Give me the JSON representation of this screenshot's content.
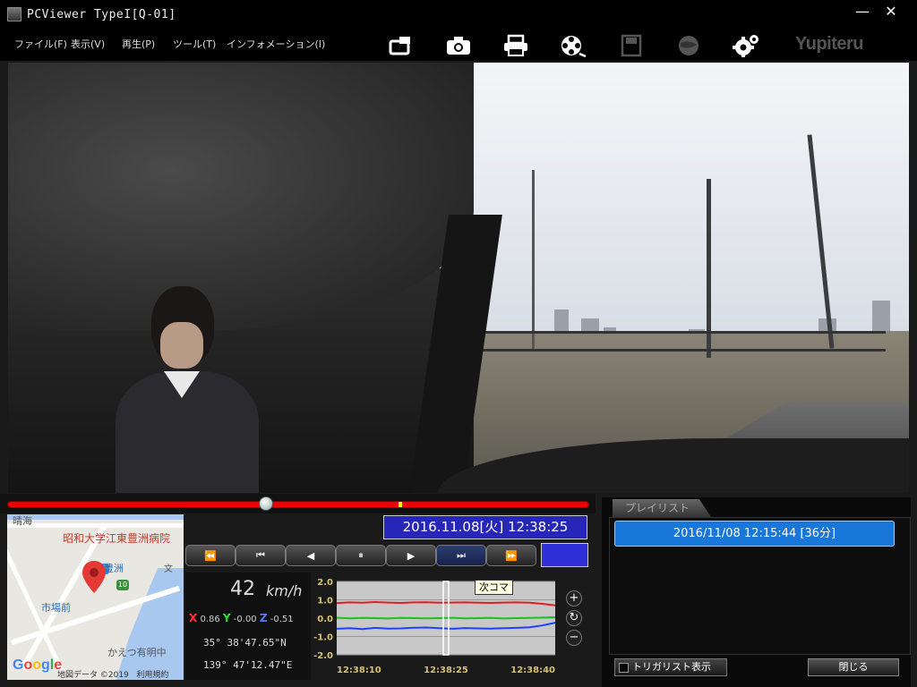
{
  "window": {
    "title": "PCViewer TypeI[Q-01]",
    "min_label": "—",
    "close_label": "✕"
  },
  "menu": {
    "items": [
      "ファイル(F)",
      "表示(V)",
      "再生(P)",
      "ツール(T)",
      "インフォメーション(I)"
    ]
  },
  "toolbar": {
    "icons": [
      "export-icon",
      "camera-icon",
      "print-icon",
      "film-reel-icon",
      "save-icon",
      "globe-icon",
      "settings-icon"
    ],
    "brand": "Yupiteru"
  },
  "playback": {
    "datetime": "2016.11.08[火] 12:38:25",
    "progress": 0.445,
    "buttons": [
      "⏪",
      "⏮",
      "◀",
      "⏸",
      "▶",
      "⏭",
      "⏩"
    ],
    "active_index": 5,
    "indicator_color": "#3030d8"
  },
  "map": {
    "label_top": "晴海",
    "hospital": "昭和大学江東豊洲病院",
    "station": "豊洲",
    "route": "10",
    "market": "市場前",
    "culture": "文",
    "ariake": "かえつ有明中",
    "logo": "Google",
    "attribution": "地図データ ©2019",
    "terms": "利用規約"
  },
  "sensor": {
    "speed": "42",
    "speed_unit": "km/h",
    "x_label": "X",
    "x_value": "0.86",
    "y_label": "Y",
    "y_value": "-0.00",
    "z_label": "Z",
    "z_value": "-0.51",
    "latitude": "35° 38'47.65\"N",
    "longitude": "139° 47'12.47\"E"
  },
  "graph": {
    "tooltip": "次コマ",
    "zoom_in": "+",
    "reset": "↻",
    "zoom_out": "−"
  },
  "chart_data": {
    "type": "line",
    "title": "",
    "xlabel": "",
    "ylabel": "",
    "y_ticks": [
      "2.0",
      "1.0",
      "0.0",
      "-1.0",
      "-2.0"
    ],
    "ylim": [
      -2.0,
      2.0
    ],
    "x_ticks": [
      "12:38:10",
      "12:38:25",
      "12:38:40"
    ],
    "cursor_x": "12:38:25",
    "series": [
      {
        "color": "#e02020",
        "values": [
          0.82,
          0.86,
          0.84,
          0.88,
          0.85,
          0.83,
          0.86,
          0.87,
          0.84,
          0.85,
          0.86,
          0.84,
          0.83,
          0.85,
          0.86,
          0.84,
          0.78,
          0.7
        ]
      },
      {
        "color": "#20c020",
        "values": [
          0.02,
          -0.01,
          0.01,
          0.0,
          -0.02,
          0.01,
          0.0,
          -0.01,
          0.0,
          0.02,
          -0.01,
          0.0,
          0.01,
          -0.02,
          0.0,
          0.01,
          0.03,
          0.05
        ]
      },
      {
        "color": "#2040ff",
        "values": [
          -0.58,
          -0.55,
          -0.6,
          -0.53,
          -0.57,
          -0.56,
          -0.52,
          -0.51,
          -0.55,
          -0.58,
          -0.54,
          -0.56,
          -0.57,
          -0.55,
          -0.53,
          -0.5,
          -0.4,
          -0.25
        ]
      }
    ]
  },
  "playlist": {
    "tab": "プレイリスト",
    "items": [
      "2016/11/08 12:15:44 [36分]"
    ],
    "trigger_label": "トリガリスト表示",
    "close_label": "閉じる"
  }
}
